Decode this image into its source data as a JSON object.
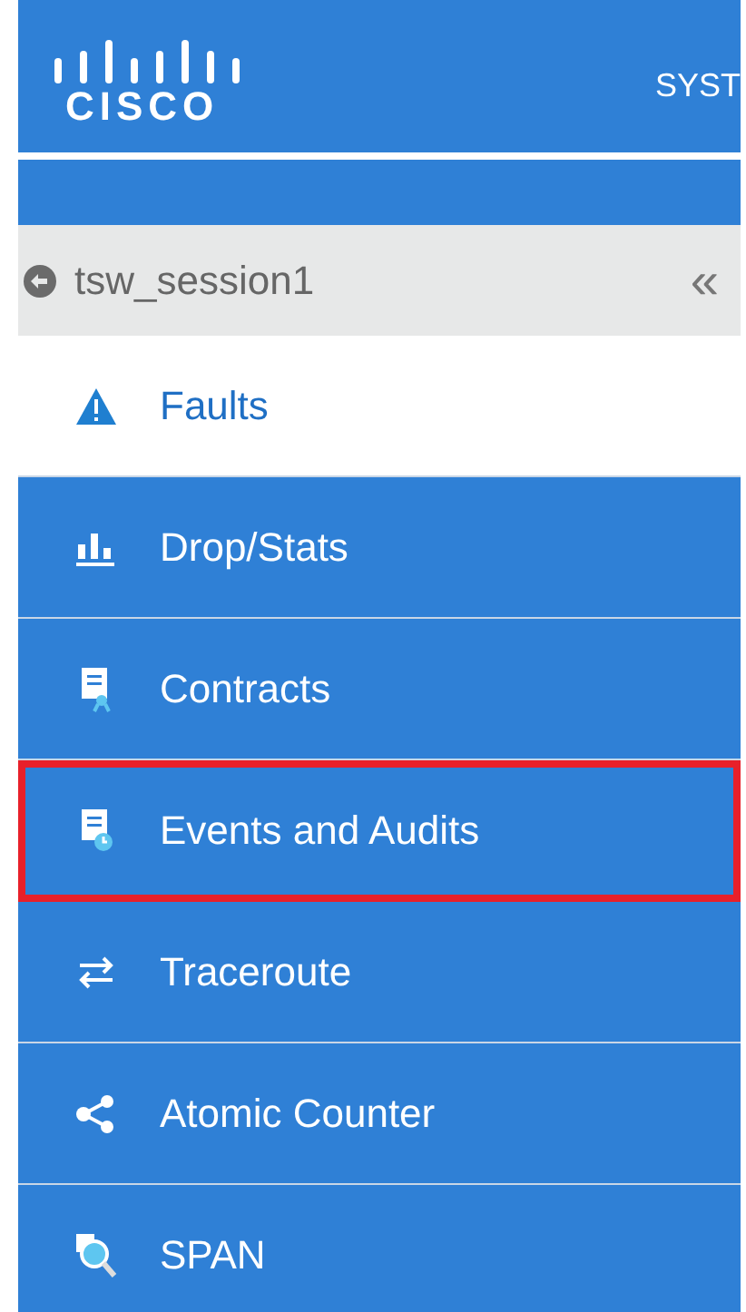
{
  "header": {
    "logo_text": "CISCO",
    "title": "SYST"
  },
  "session": {
    "name": "tsw_session1",
    "collapse": "«"
  },
  "menu": [
    {
      "kind": "alert",
      "label": "Faults",
      "selected": true,
      "highlighted": false
    },
    {
      "kind": "chart",
      "label": "Drop/Stats",
      "selected": false,
      "highlighted": false
    },
    {
      "kind": "contract",
      "label": "Contracts",
      "selected": false,
      "highlighted": false
    },
    {
      "kind": "events",
      "label": "Events and Audits",
      "selected": false,
      "highlighted": true
    },
    {
      "kind": "traceroute",
      "label": "Traceroute",
      "selected": false,
      "highlighted": false
    },
    {
      "kind": "share",
      "label": "Atomic Counter",
      "selected": false,
      "highlighted": false
    },
    {
      "kind": "span",
      "label": "SPAN",
      "selected": false,
      "highlighted": false
    }
  ]
}
